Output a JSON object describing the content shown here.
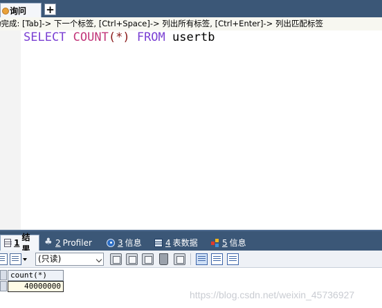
{
  "top_tabs": {
    "query_tab_label": "询问",
    "new_tab_symbol": "+"
  },
  "hint_bar": {
    "text": "动完成: [Tab]-> 下一个标签, [Ctrl+Space]-> 列出所有标签, [Ctrl+Enter]-> 列出匹配标签"
  },
  "editor": {
    "tokens": {
      "select": "SELECT",
      "count": "COUNT",
      "args": "(*)",
      "from": "FROM",
      "table": "usertb"
    }
  },
  "result_tabs": [
    {
      "num": "1",
      "label": "结果",
      "icon": "grid-icon",
      "active": true
    },
    {
      "num": "2",
      "label": "Profiler",
      "icon": "profiler-icon",
      "active": false
    },
    {
      "num": "3",
      "label": "信息",
      "icon": "info-icon",
      "active": false
    },
    {
      "num": "4",
      "label": "表数据",
      "icon": "table-icon",
      "active": false
    },
    {
      "num": "5",
      "label": "信息",
      "icon": "multi-info-icon",
      "active": false
    }
  ],
  "toolbar": {
    "mode_select_value": "(只读)"
  },
  "result_grid": {
    "columns": [
      "count(*)"
    ],
    "rows": [
      [
        "40000000"
      ]
    ]
  },
  "watermark": "https://blog.csdn.net/weixin_45736927",
  "colors": {
    "tab_bar": "#3b5777",
    "keyword": "#7a3fd3",
    "function": "#c2367a"
  }
}
